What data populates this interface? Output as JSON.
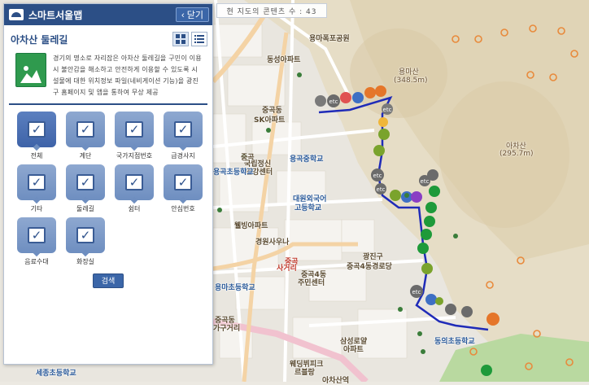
{
  "app": {
    "title": "스마트서울맵",
    "close_label": "닫기"
  },
  "panel": {
    "title": "아차산 둘레길",
    "description": "경기의 명소로 자리잡은 아차산 둘레길을 구민이 이용시 불안감을 해소하고 안전하게 이용할 수 있도록 시설물에 대한 위치정보 파일(네비게이션 기능)을 광진구 홈페이지 및 앱을 통하여 무상 제공",
    "categories": [
      {
        "label": "전체",
        "checked": true,
        "selected": true
      },
      {
        "label": "계단",
        "checked": true
      },
      {
        "label": "국가지점번호",
        "checked": true
      },
      {
        "label": "급경사지",
        "checked": true
      },
      {
        "label": "기타",
        "checked": true
      },
      {
        "label": "둘레길",
        "checked": true
      },
      {
        "label": "쉼터",
        "checked": true
      },
      {
        "label": "안심번호",
        "checked": true
      },
      {
        "label": "음료수대",
        "checked": true
      },
      {
        "label": "화장실",
        "checked": true
      }
    ],
    "search_label": "검색",
    "icons": {
      "grid_view": "grid-view-icon",
      "list_view": "list-view-icon",
      "check": "checkmark-icon"
    }
  },
  "content_count_text": "현 지도의 콘텐츠 수 : 43",
  "map": {
    "labels": [
      "용마폭포공원",
      "동성아파트",
      "용마산",
      "(348.5m)",
      "중곡동",
      "SK아파트",
      "아차산",
      "(295.7m)",
      "중곡",
      "국립정신",
      "건강센터",
      "용곡중학교",
      "용곡초등학교",
      "대원외국어",
      "고등학교",
      "웰빙아파트",
      "경원사우나",
      "광진구",
      "중곡4동경로당",
      "중곡",
      "사거리",
      "중곡4동",
      "주민센터",
      "용마초등학교",
      "중곡동",
      "가구거리",
      "삼성로얄",
      "아파트",
      "웨딩뷔피크",
      "르블랑",
      "동의초등학교",
      "세종초등학교",
      "아차산역"
    ],
    "colors": {
      "route": "#1f2bb8",
      "road": "#f4d3a5",
      "panel_header": "#2c4f86",
      "category": "#6e8ec0"
    }
  }
}
